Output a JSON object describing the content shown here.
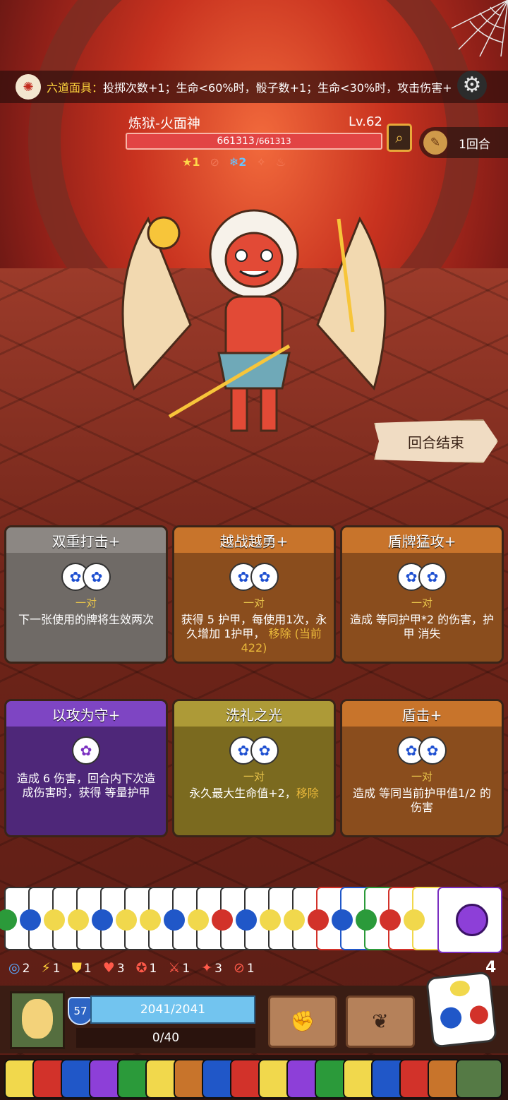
{
  "top_buff": {
    "name": "六道面具：",
    "text": "投掷次数+1；生命<60%时，骰子数+1；生命<30%时，攻击伤害+"
  },
  "boss": {
    "name": "炼狱-火面神",
    "level": "Lv.62",
    "hp_current": "661313",
    "hp_max": "/661313"
  },
  "round": {
    "label": "1回合"
  },
  "boss_status": [
    {
      "icon": "star-icon",
      "value": "1"
    },
    {
      "icon": "fire-icon",
      "value": ""
    },
    {
      "icon": "frost-icon",
      "value": "2"
    },
    {
      "icon": "buff-icon",
      "value": ""
    },
    {
      "icon": "burn-icon",
      "value": ""
    }
  ],
  "end_turn": {
    "label": "回合结束"
  },
  "cards": [
    {
      "title": "双重打击+",
      "pair": "一对",
      "desc": "下一张使用的牌将生效两次",
      "extra": ""
    },
    {
      "title": "越战越勇+",
      "pair": "一对",
      "desc": "获得 5 护甲，每使用1次，永久增加 1护甲，",
      "extra": "移除 (当前422)"
    },
    {
      "title": "盾牌猛攻+",
      "pair": "一对",
      "desc": "造成 等同护甲*2 的伤害，护甲 消失",
      "extra": ""
    },
    {
      "title": "以攻为守+",
      "pair": "",
      "desc": "造成 6 伤害，回合内下次造成伤害时，获得 等量护甲",
      "extra": ""
    },
    {
      "title": "洗礼之光",
      "pair": "一对",
      "desc": "永久最大生命值+2，",
      "extra": "移除"
    },
    {
      "title": "盾击+",
      "pair": "一对",
      "desc": "造成 等同当前护甲值1/2 的伤害",
      "extra": ""
    }
  ],
  "player_stats": [
    {
      "icon": "vision-icon",
      "value": "2",
      "color": "#5aa9ff"
    },
    {
      "icon": "lightning-icon",
      "value": "1",
      "color": "#ffd23a"
    },
    {
      "icon": "shield-icon",
      "value": "1",
      "color": "#ffd23a"
    },
    {
      "icon": "heart-shield-icon",
      "value": "3",
      "color": "#ff5a4a"
    },
    {
      "icon": "target-icon",
      "value": "1",
      "color": "#ff5a4a"
    },
    {
      "icon": "sword-shield-icon",
      "value": "1",
      "color": "#ff5a4a"
    },
    {
      "icon": "chain-icon",
      "value": "3",
      "color": "#ff5a4a"
    },
    {
      "icon": "no-attack-icon",
      "value": "1",
      "color": "#ff5a4a"
    }
  ],
  "dice_count": "4",
  "player": {
    "level": "57",
    "hp": "2041/2041",
    "exp": "0/40"
  },
  "colors": {
    "hp_boss": "#e24444",
    "hp_player": "#72c4ef",
    "gold": "#e9b83a"
  }
}
